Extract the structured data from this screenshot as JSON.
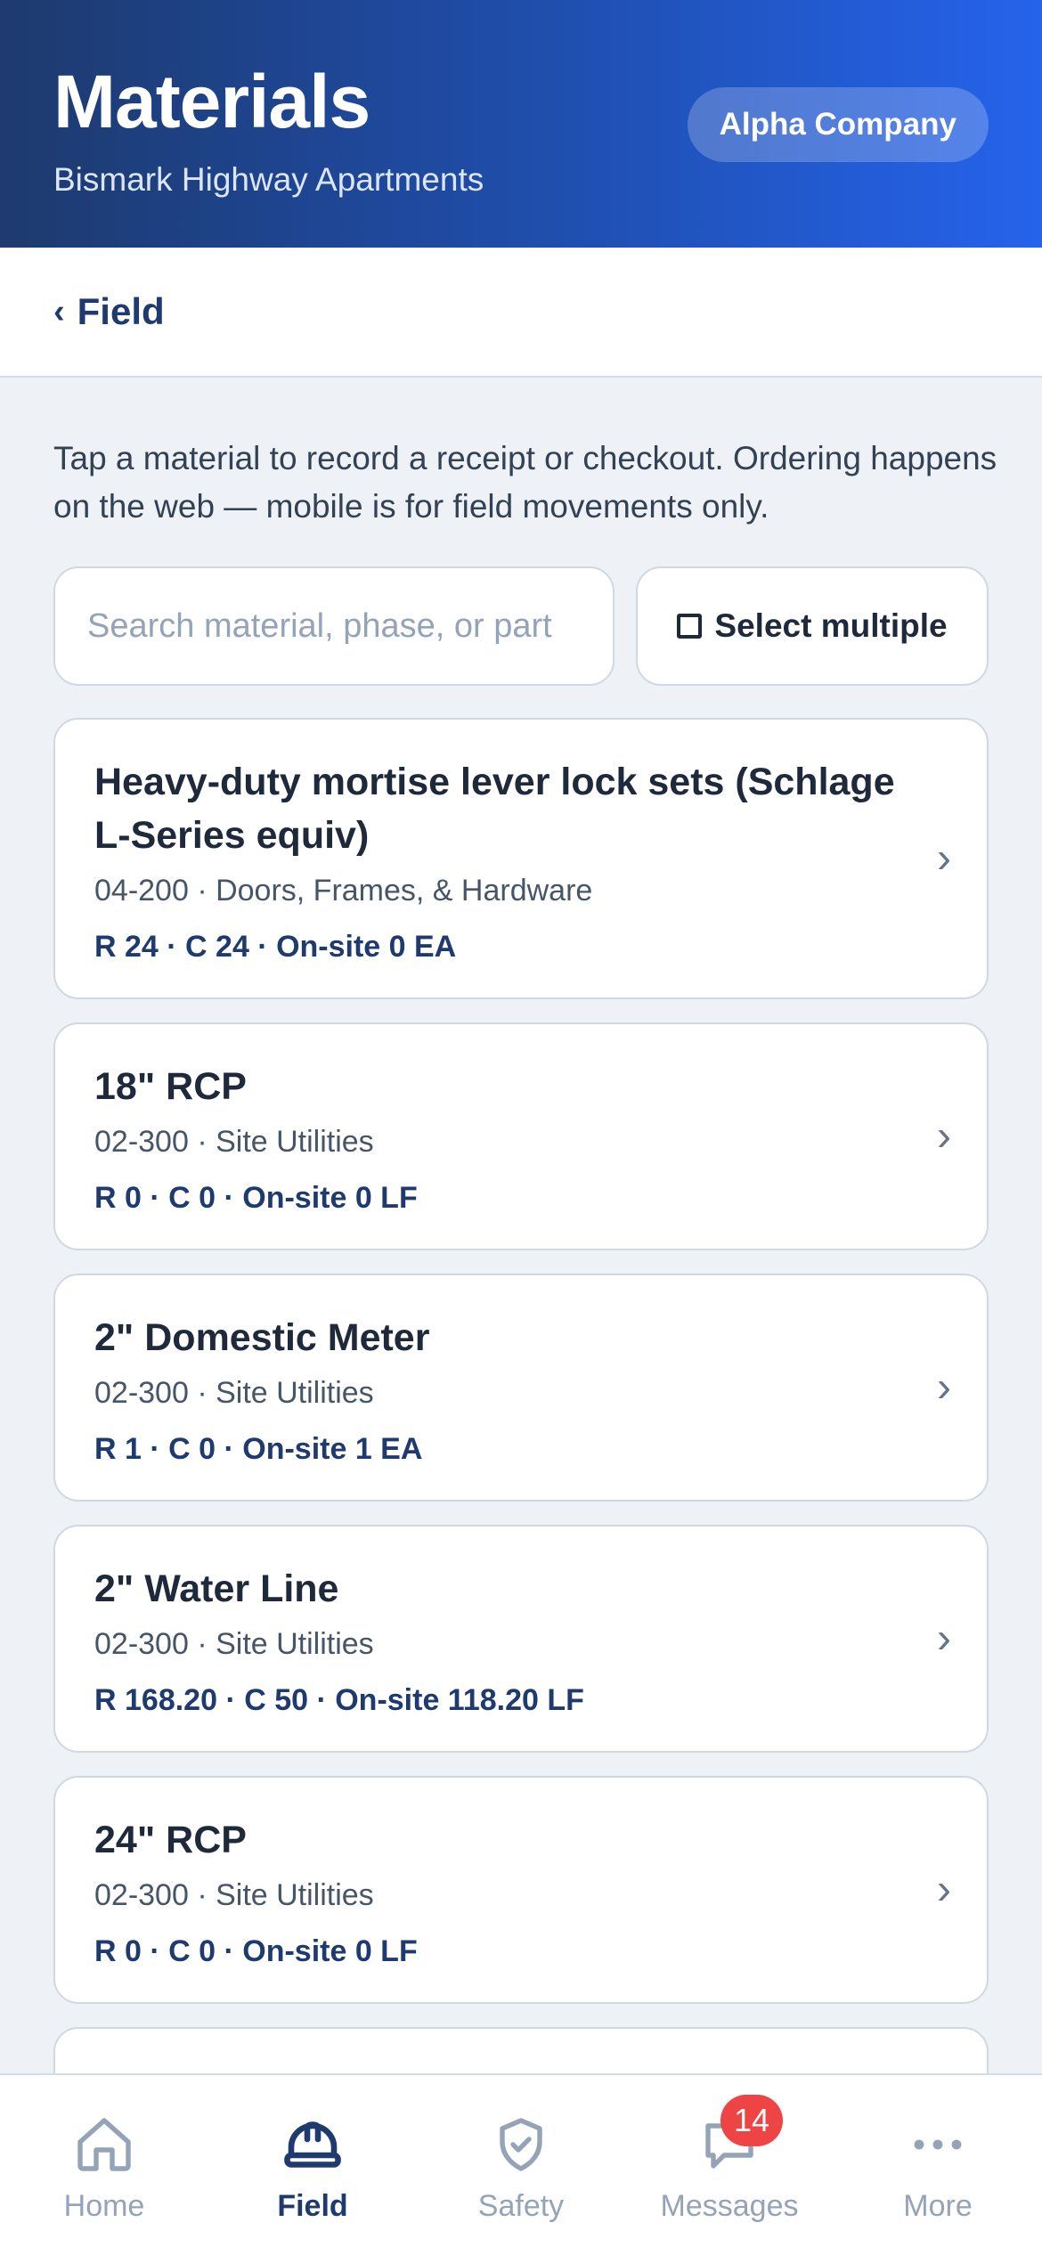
{
  "header": {
    "title": "Materials",
    "subtitle": "Bismark Highway Apartments",
    "company": "Alpha Company"
  },
  "nav_back": {
    "label": "Field",
    "icon": "chevron-left-icon"
  },
  "intro": "Tap a material to record a receipt or checkout. Ordering happens on the web — mobile is for field movements only.",
  "search": {
    "placeholder": "Search material, phase, or part",
    "value": ""
  },
  "select_multiple": {
    "label": "Select multiple",
    "icon": "checkbox-icon"
  },
  "materials": [
    {
      "name": " Heavy-duty mortise lever lock sets (Schlage L-Series equiv)",
      "phase": "04-200 · Doors, Frames, & Hardware",
      "stats": "R 24 · C 24 · On-site 0 EA"
    },
    {
      "name": "18\" RCP",
      "phase": "02-300 · Site Utilities",
      "stats": "R 0 · C 0 · On-site 0 LF"
    },
    {
      "name": "2\" Domestic Meter",
      "phase": "02-300 · Site Utilities",
      "stats": "R 1 · C 0 · On-site 1 EA"
    },
    {
      "name": "2\" Water Line",
      "phase": "02-300 · Site Utilities",
      "stats": "R 168.20 · C 50 · On-site 118.20 LF"
    },
    {
      "name": "24\" RCP",
      "phase": "02-300 · Site Utilities",
      "stats": "R 0 · C 0 · On-site 0 LF"
    }
  ],
  "bottom_nav": [
    {
      "label": "Home",
      "icon": "home-icon",
      "active": false
    },
    {
      "label": "Field",
      "icon": "hard-hat-icon",
      "active": true
    },
    {
      "label": "Safety",
      "icon": "shield-check-icon",
      "active": false
    },
    {
      "label": "Messages",
      "icon": "chat-bubble-icon",
      "active": false,
      "badge": "14"
    },
    {
      "label": "More",
      "icon": "more-dots-icon",
      "active": false
    }
  ],
  "colors": {
    "brand_dark": "#1e3a6e",
    "brand_accent": "#2563eb",
    "badge": "#ef4444"
  }
}
